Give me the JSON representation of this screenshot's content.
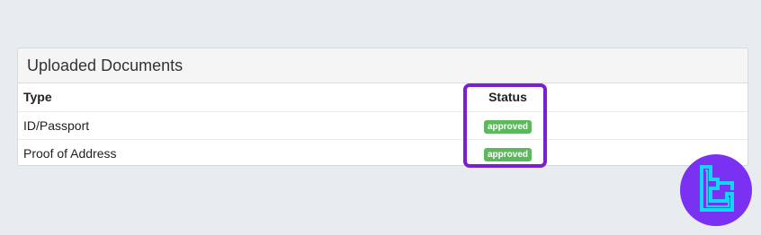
{
  "panel": {
    "title": "Uploaded Documents"
  },
  "table": {
    "columns": [
      "Type",
      "Status"
    ],
    "rows": [
      {
        "type": "ID/Passport",
        "status": "approved"
      },
      {
        "type": "Proof of Address",
        "status": "approved"
      }
    ]
  },
  "colors": {
    "page_background": "#e9ecef",
    "approved_badge": "#5cb85c",
    "highlight": "#7b1fd1",
    "logo_background": "#7a31f2",
    "logo_mark": "#12d6f5"
  },
  "icons": {
    "logo": "tc-logo-icon"
  }
}
